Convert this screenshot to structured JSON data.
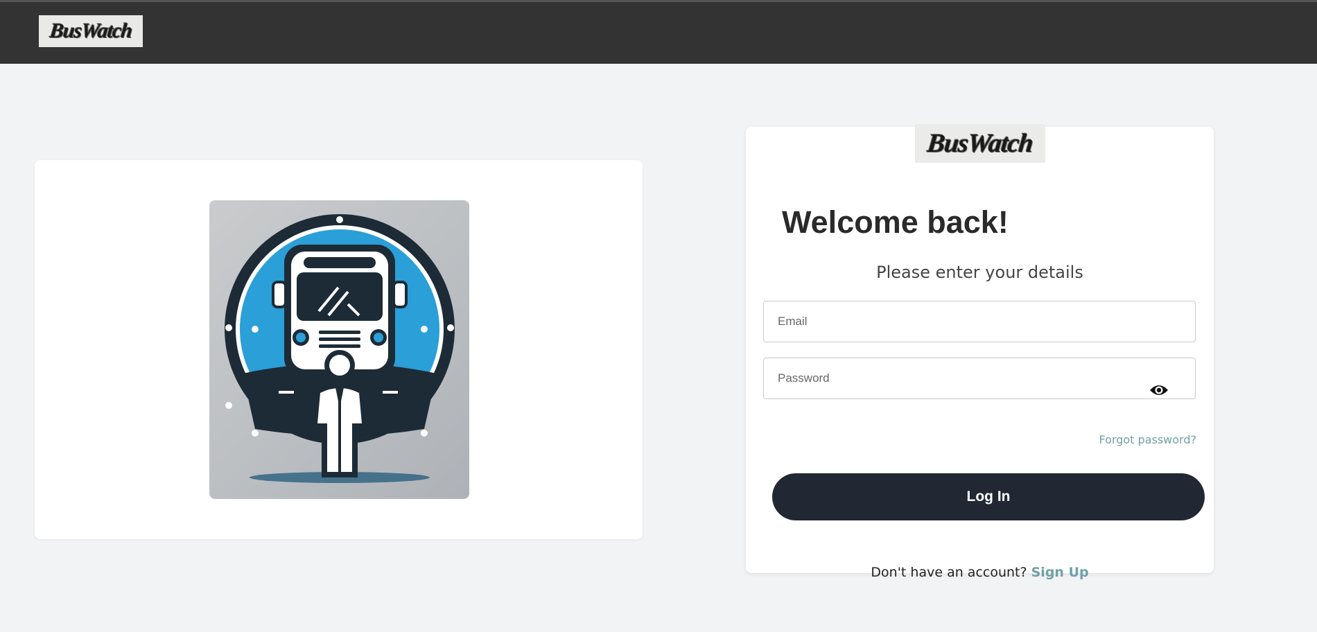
{
  "header": {
    "logo_text": "BusWatch"
  },
  "login": {
    "logo_text": "BusWatch",
    "title": "Welcome back!",
    "subtitle": "Please enter your details",
    "email_placeholder": "Email",
    "password_placeholder": "Password",
    "forgot_password": "Forgot password?",
    "login_button": "Log In",
    "signup_prompt": "Don't have an account?",
    "signup_link": "Sign Up"
  },
  "colors": {
    "topbar": "#333333",
    "background": "#f2f3f5",
    "button": "#212833",
    "link": "#6fa1a6",
    "hero_accent": "#2a9fd8"
  },
  "icons": {
    "password_toggle": "eye-icon",
    "hero": "bus-driver-illustration"
  }
}
